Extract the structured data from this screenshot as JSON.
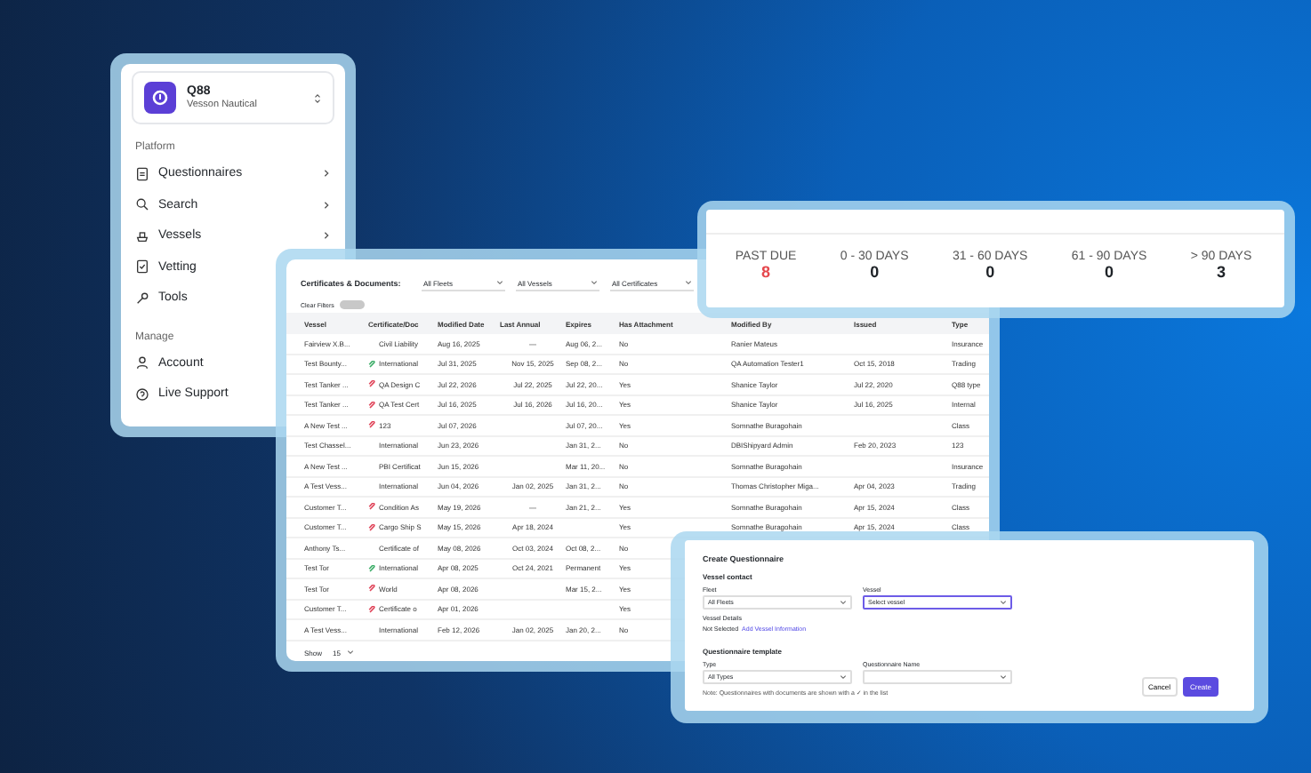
{
  "sidebar": {
    "org": {
      "name": "Q88",
      "subtitle": "Vesson Nautical"
    },
    "sections": [
      {
        "title": "Platform",
        "items": [
          {
            "label": "Questionnaires",
            "kind": "document",
            "chevron": true
          },
          {
            "label": "Search",
            "kind": "search",
            "chevron": true
          },
          {
            "label": "Vessels",
            "kind": "ship",
            "chevron": true
          },
          {
            "label": "Vetting",
            "kind": "check",
            "chevron": false
          },
          {
            "label": "Tools",
            "kind": "wrench",
            "chevron": false
          }
        ]
      },
      {
        "title": "Manage",
        "items": [
          {
            "label": "Account",
            "kind": "person",
            "chevron": false
          },
          {
            "label": "Live Support",
            "kind": "help",
            "chevron": false
          }
        ]
      }
    ]
  },
  "table": {
    "title": "Certificates & Documents:",
    "filters": [
      "All Fleets",
      "All Vessels",
      "All Certificates"
    ],
    "clear_filters": "Clear Filters",
    "columns": [
      "Vessel",
      "Certificate/Doc",
      "Modified Date",
      "Last Annual",
      "Expires",
      "Has Attachment",
      "Modified By",
      "Issued",
      "Type"
    ],
    "rows": [
      {
        "vessel": "Fairview X.B...",
        "certificate": "Civil Liability",
        "modified_date": "Aug 16, 2025",
        "last_annual": "—",
        "expires": "Aug 06, 2...",
        "has_attachment": "No",
        "modified_by": "Ranier Mateus",
        "type": "Insurance"
      },
      {
        "vessel": "Test Bounty...",
        "color": "#3fae6a",
        "certificate": "International",
        "modified_date": "Jul 31, 2025",
        "last_annual": "Nov 15, 2025",
        "expires": "Sep 08, 2...",
        "has_attachment": "No",
        "modified_by": "QA Automation Tester1",
        "issued": "Oct 15, 2018",
        "type": "Trading"
      },
      {
        "vessel": "Test Tanker ...",
        "color": "#e0455a",
        "certificate": "QA Design C",
        "modified_date": "Jul 22, 2026",
        "last_annual": "Jul 22, 2025",
        "expires": "Jul 22, 20...",
        "has_attachment": "Yes",
        "modified_by": "Shanice Taylor",
        "issued": "Jul 22, 2020",
        "type": "Q88 type"
      },
      {
        "vessel": "Test Tanker ...",
        "color": "#e0455a",
        "certificate": "QA Test Cert",
        "modified_date": "Jul 16, 2025",
        "last_annual": "Jul 16, 2026",
        "expires": "Jul 16, 20...",
        "has_attachment": "Yes",
        "modified_by": "Shanice Taylor",
        "issued": "Jul 16, 2025",
        "type": "Internal"
      },
      {
        "vessel": "A New Test ...",
        "color": "#e0455a",
        "certificate": "123",
        "modified_date": "Jul 07, 2026",
        "expires": "Jul 07, 20...",
        "has_attachment": "Yes",
        "modified_by": "Somnathe Buragohain",
        "type": "Class"
      },
      {
        "vessel": "Test Chassel...",
        "certificate": "International",
        "modified_date": "Jun 23, 2026",
        "expires": "Jan 31, 2...",
        "has_attachment": "No",
        "modified_by": "DBIShipyard Admin",
        "issued": "Feb 20, 2023",
        "type": "123"
      },
      {
        "vessel": "A New Test ...",
        "certificate": "PBI Certificat",
        "modified_date": "Jun 15, 2026",
        "expires": "Mar 11, 20...",
        "has_attachment": "No",
        "modified_by": "Somnathe Buragohain",
        "type": "Insurance"
      },
      {
        "vessel": "A Test Vess...",
        "certificate": "International",
        "modified_date": "Jun 04, 2026",
        "last_annual": "Jan 02, 2025",
        "expires": "Jan 31, 2...",
        "has_attachment": "No",
        "modified_by": "Thomas Christopher Miga...",
        "issued": "Apr 04, 2023",
        "type": "Trading"
      },
      {
        "vessel": "Customer T...",
        "color": "#e0455a",
        "certificate": "Condition As",
        "modified_date": "May 19, 2026",
        "last_annual": "—",
        "expires": "Jan 21, 2...",
        "has_attachment": "Yes",
        "modified_by": "Somnathe Buragohain",
        "issued": "Apr 15, 2024",
        "type": "Class"
      },
      {
        "vessel": "Customer T...",
        "color": "#e0455a",
        "certificate": "Cargo Ship S",
        "modified_date": "May 15, 2026",
        "last_annual": "Apr 18, 2024",
        "has_attachment": "Yes",
        "modified_by": "Somnathe Buragohain",
        "issued": "Apr 15, 2024",
        "type": "Class"
      },
      {
        "vessel": "Anthony Ts...",
        "certificate": "Certificate of",
        "modified_date": "May 08, 2026",
        "last_annual": "Oct 03, 2024",
        "expires": "Oct 08, 2...",
        "has_attachment": "No"
      },
      {
        "vessel": "Test Tor",
        "color": "#3fae6a",
        "certificate": "International",
        "modified_date": "Apr 08, 2025",
        "last_annual": "Oct 24, 2021",
        "expires": "Permanent",
        "has_attachment": "Yes"
      },
      {
        "vessel": "Test Tor",
        "color": "#e0455a",
        "certificate": "World",
        "modified_date": "Apr 08, 2026",
        "expires": "Mar 15, 2...",
        "has_attachment": "Yes"
      },
      {
        "vessel": "Customer T...",
        "color": "#e0455a",
        "certificate": "Certificate o",
        "modified_date": "Apr 01, 2026",
        "has_attachment": "Yes"
      },
      {
        "vessel": "A Test Vess...",
        "certificate": "International",
        "modified_date": "Feb 12, 2026",
        "last_annual": "Jan 02, 2025",
        "expires": "Jan 20, 2...",
        "has_attachment": "No"
      }
    ],
    "show_label": "Show",
    "page_size": "15"
  },
  "aging": [
    {
      "label": "PAST DUE",
      "value": "8",
      "color": "#e5484d"
    },
    {
      "label": "0 - 30 DAYS",
      "value": "0",
      "color": "#1f2328"
    },
    {
      "label": "31 - 60 DAYS",
      "value": "0",
      "color": "#1f2328"
    },
    {
      "label": "61 - 90 DAYS",
      "value": "0",
      "color": "#1f2328"
    },
    {
      "label": "> 90 DAYS",
      "value": "3",
      "color": "#1f2328"
    }
  ],
  "dialog": {
    "title": "Create Questionnaire",
    "section_1": "Vessel contact",
    "fleet": {
      "label": "Fleet",
      "value": "All Fleets"
    },
    "vessel": {
      "label": "Vessel",
      "value": "Select vessel"
    },
    "details_label": "Vessel Details",
    "details_text": "Not Selected",
    "details_link": "Add Vessel Information",
    "section_2": "Questionnaire template",
    "type": {
      "label": "Type",
      "value": "All Types"
    },
    "name": {
      "label": "Questionnaire Name"
    },
    "note": "Note: Questionnaires with documents are shown with a ✓ in the list",
    "buttons": [
      {
        "label": "Cancel",
        "kind": "secondary"
      },
      {
        "label": "Create",
        "kind": "primary"
      }
    ]
  }
}
